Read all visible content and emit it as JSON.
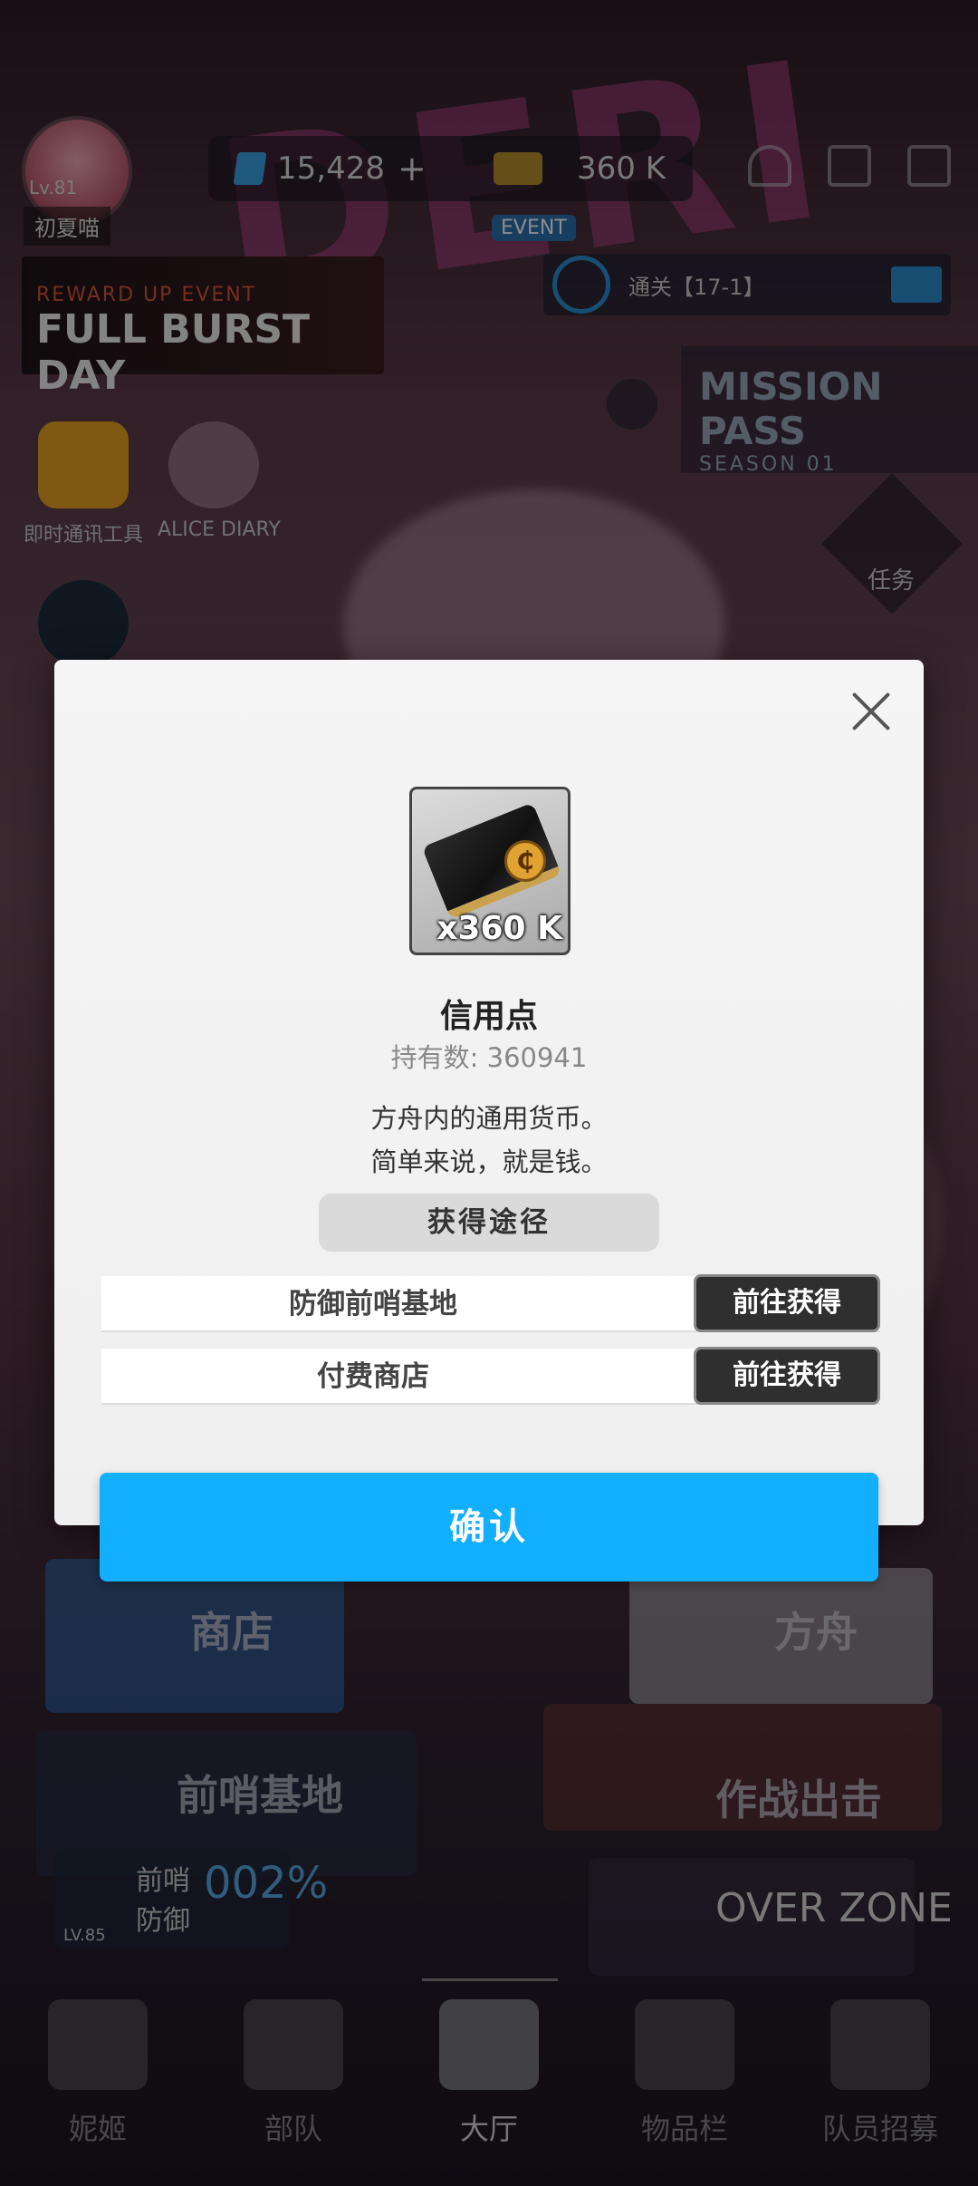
{
  "background": {
    "header": {
      "gems": "15,428",
      "gems_plus": "+",
      "credits": "360 K",
      "player_level": "Lv.81",
      "player_name": "初夏喵"
    },
    "event_banner": {
      "subtitle": "REWARD UP EVENT",
      "title": "FULL BURST DAY"
    },
    "event_tag": "EVENT",
    "quest": "通关【17-1】",
    "mission_pass": {
      "title": "MISSION PASS",
      "season": "SEASON 01"
    },
    "side_apps": [
      {
        "label": "即时通讯工具"
      },
      {
        "label": "ALICE DIARY"
      }
    ],
    "task_label": "任务",
    "tiles": {
      "shop": "商店",
      "ark": "方舟",
      "outpost": "前哨基地",
      "battle": "作战出击",
      "outpost_defense": "前哨\n防御",
      "outpost_percent": "002%",
      "outpost_level": "LV.85",
      "overzone": "OVER ZONE"
    },
    "nav": [
      {
        "label": "妮姬"
      },
      {
        "label": "部队"
      },
      {
        "label": "大厅"
      },
      {
        "label": "物品栏"
      },
      {
        "label": "队员招募"
      }
    ]
  },
  "modal": {
    "item_quantity": "x360 K",
    "item_name": "信用点",
    "owned": "持有数: 360941",
    "description_line1": "方舟内的通用货币。",
    "description_line2": "简单来说，就是钱。",
    "sources_header": "获得途径",
    "sources": [
      {
        "name": "防御前哨基地",
        "button": "前往获得"
      },
      {
        "name": "付费商店",
        "button": "前往获得"
      }
    ],
    "confirm": "确认"
  },
  "colors": {
    "confirm_blue": "#12aeff",
    "go_button": "#2f2f2f",
    "modal_bg": "#f2f2f2"
  }
}
